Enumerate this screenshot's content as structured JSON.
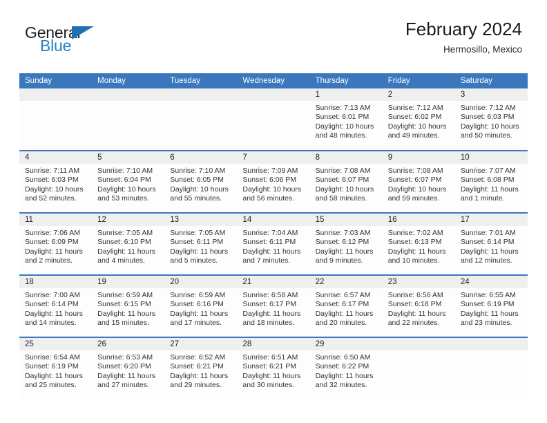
{
  "brand": {
    "name_part1": "General",
    "name_part2": "Blue",
    "triangle_color": "#1f6fb5",
    "blue_color": "#2980c4"
  },
  "header": {
    "title": "February 2024",
    "subtitle": "Hermosillo, Mexico",
    "header_bg": "#3a77bc",
    "daynum_bg": "#efefef"
  },
  "weekdays": [
    "Sunday",
    "Monday",
    "Tuesday",
    "Wednesday",
    "Thursday",
    "Friday",
    "Saturday"
  ],
  "weeks": [
    [
      {
        "day": "",
        "lines": []
      },
      {
        "day": "",
        "lines": []
      },
      {
        "day": "",
        "lines": []
      },
      {
        "day": "",
        "lines": []
      },
      {
        "day": "1",
        "lines": [
          "Sunrise: 7:13 AM",
          "Sunset: 6:01 PM",
          "Daylight: 10 hours",
          "and 48 minutes."
        ]
      },
      {
        "day": "2",
        "lines": [
          "Sunrise: 7:12 AM",
          "Sunset: 6:02 PM",
          "Daylight: 10 hours",
          "and 49 minutes."
        ]
      },
      {
        "day": "3",
        "lines": [
          "Sunrise: 7:12 AM",
          "Sunset: 6:03 PM",
          "Daylight: 10 hours",
          "and 50 minutes."
        ]
      }
    ],
    [
      {
        "day": "4",
        "lines": [
          "Sunrise: 7:11 AM",
          "Sunset: 6:03 PM",
          "Daylight: 10 hours",
          "and 52 minutes."
        ]
      },
      {
        "day": "5",
        "lines": [
          "Sunrise: 7:10 AM",
          "Sunset: 6:04 PM",
          "Daylight: 10 hours",
          "and 53 minutes."
        ]
      },
      {
        "day": "6",
        "lines": [
          "Sunrise: 7:10 AM",
          "Sunset: 6:05 PM",
          "Daylight: 10 hours",
          "and 55 minutes."
        ]
      },
      {
        "day": "7",
        "lines": [
          "Sunrise: 7:09 AM",
          "Sunset: 6:06 PM",
          "Daylight: 10 hours",
          "and 56 minutes."
        ]
      },
      {
        "day": "8",
        "lines": [
          "Sunrise: 7:08 AM",
          "Sunset: 6:07 PM",
          "Daylight: 10 hours",
          "and 58 minutes."
        ]
      },
      {
        "day": "9",
        "lines": [
          "Sunrise: 7:08 AM",
          "Sunset: 6:07 PM",
          "Daylight: 10 hours",
          "and 59 minutes."
        ]
      },
      {
        "day": "10",
        "lines": [
          "Sunrise: 7:07 AM",
          "Sunset: 6:08 PM",
          "Daylight: 11 hours",
          "and 1 minute."
        ]
      }
    ],
    [
      {
        "day": "11",
        "lines": [
          "Sunrise: 7:06 AM",
          "Sunset: 6:09 PM",
          "Daylight: 11 hours",
          "and 2 minutes."
        ]
      },
      {
        "day": "12",
        "lines": [
          "Sunrise: 7:05 AM",
          "Sunset: 6:10 PM",
          "Daylight: 11 hours",
          "and 4 minutes."
        ]
      },
      {
        "day": "13",
        "lines": [
          "Sunrise: 7:05 AM",
          "Sunset: 6:11 PM",
          "Daylight: 11 hours",
          "and 5 minutes."
        ]
      },
      {
        "day": "14",
        "lines": [
          "Sunrise: 7:04 AM",
          "Sunset: 6:11 PM",
          "Daylight: 11 hours",
          "and 7 minutes."
        ]
      },
      {
        "day": "15",
        "lines": [
          "Sunrise: 7:03 AM",
          "Sunset: 6:12 PM",
          "Daylight: 11 hours",
          "and 9 minutes."
        ]
      },
      {
        "day": "16",
        "lines": [
          "Sunrise: 7:02 AM",
          "Sunset: 6:13 PM",
          "Daylight: 11 hours",
          "and 10 minutes."
        ]
      },
      {
        "day": "17",
        "lines": [
          "Sunrise: 7:01 AM",
          "Sunset: 6:14 PM",
          "Daylight: 11 hours",
          "and 12 minutes."
        ]
      }
    ],
    [
      {
        "day": "18",
        "lines": [
          "Sunrise: 7:00 AM",
          "Sunset: 6:14 PM",
          "Daylight: 11 hours",
          "and 14 minutes."
        ]
      },
      {
        "day": "19",
        "lines": [
          "Sunrise: 6:59 AM",
          "Sunset: 6:15 PM",
          "Daylight: 11 hours",
          "and 15 minutes."
        ]
      },
      {
        "day": "20",
        "lines": [
          "Sunrise: 6:59 AM",
          "Sunset: 6:16 PM",
          "Daylight: 11 hours",
          "and 17 minutes."
        ]
      },
      {
        "day": "21",
        "lines": [
          "Sunrise: 6:58 AM",
          "Sunset: 6:17 PM",
          "Daylight: 11 hours",
          "and 18 minutes."
        ]
      },
      {
        "day": "22",
        "lines": [
          "Sunrise: 6:57 AM",
          "Sunset: 6:17 PM",
          "Daylight: 11 hours",
          "and 20 minutes."
        ]
      },
      {
        "day": "23",
        "lines": [
          "Sunrise: 6:56 AM",
          "Sunset: 6:18 PM",
          "Daylight: 11 hours",
          "and 22 minutes."
        ]
      },
      {
        "day": "24",
        "lines": [
          "Sunrise: 6:55 AM",
          "Sunset: 6:19 PM",
          "Daylight: 11 hours",
          "and 23 minutes."
        ]
      }
    ],
    [
      {
        "day": "25",
        "lines": [
          "Sunrise: 6:54 AM",
          "Sunset: 6:19 PM",
          "Daylight: 11 hours",
          "and 25 minutes."
        ]
      },
      {
        "day": "26",
        "lines": [
          "Sunrise: 6:53 AM",
          "Sunset: 6:20 PM",
          "Daylight: 11 hours",
          "and 27 minutes."
        ]
      },
      {
        "day": "27",
        "lines": [
          "Sunrise: 6:52 AM",
          "Sunset: 6:21 PM",
          "Daylight: 11 hours",
          "and 29 minutes."
        ]
      },
      {
        "day": "28",
        "lines": [
          "Sunrise: 6:51 AM",
          "Sunset: 6:21 PM",
          "Daylight: 11 hours",
          "and 30 minutes."
        ]
      },
      {
        "day": "29",
        "lines": [
          "Sunrise: 6:50 AM",
          "Sunset: 6:22 PM",
          "Daylight: 11 hours",
          "and 32 minutes."
        ]
      },
      {
        "day": "",
        "lines": []
      },
      {
        "day": "",
        "lines": []
      }
    ]
  ]
}
